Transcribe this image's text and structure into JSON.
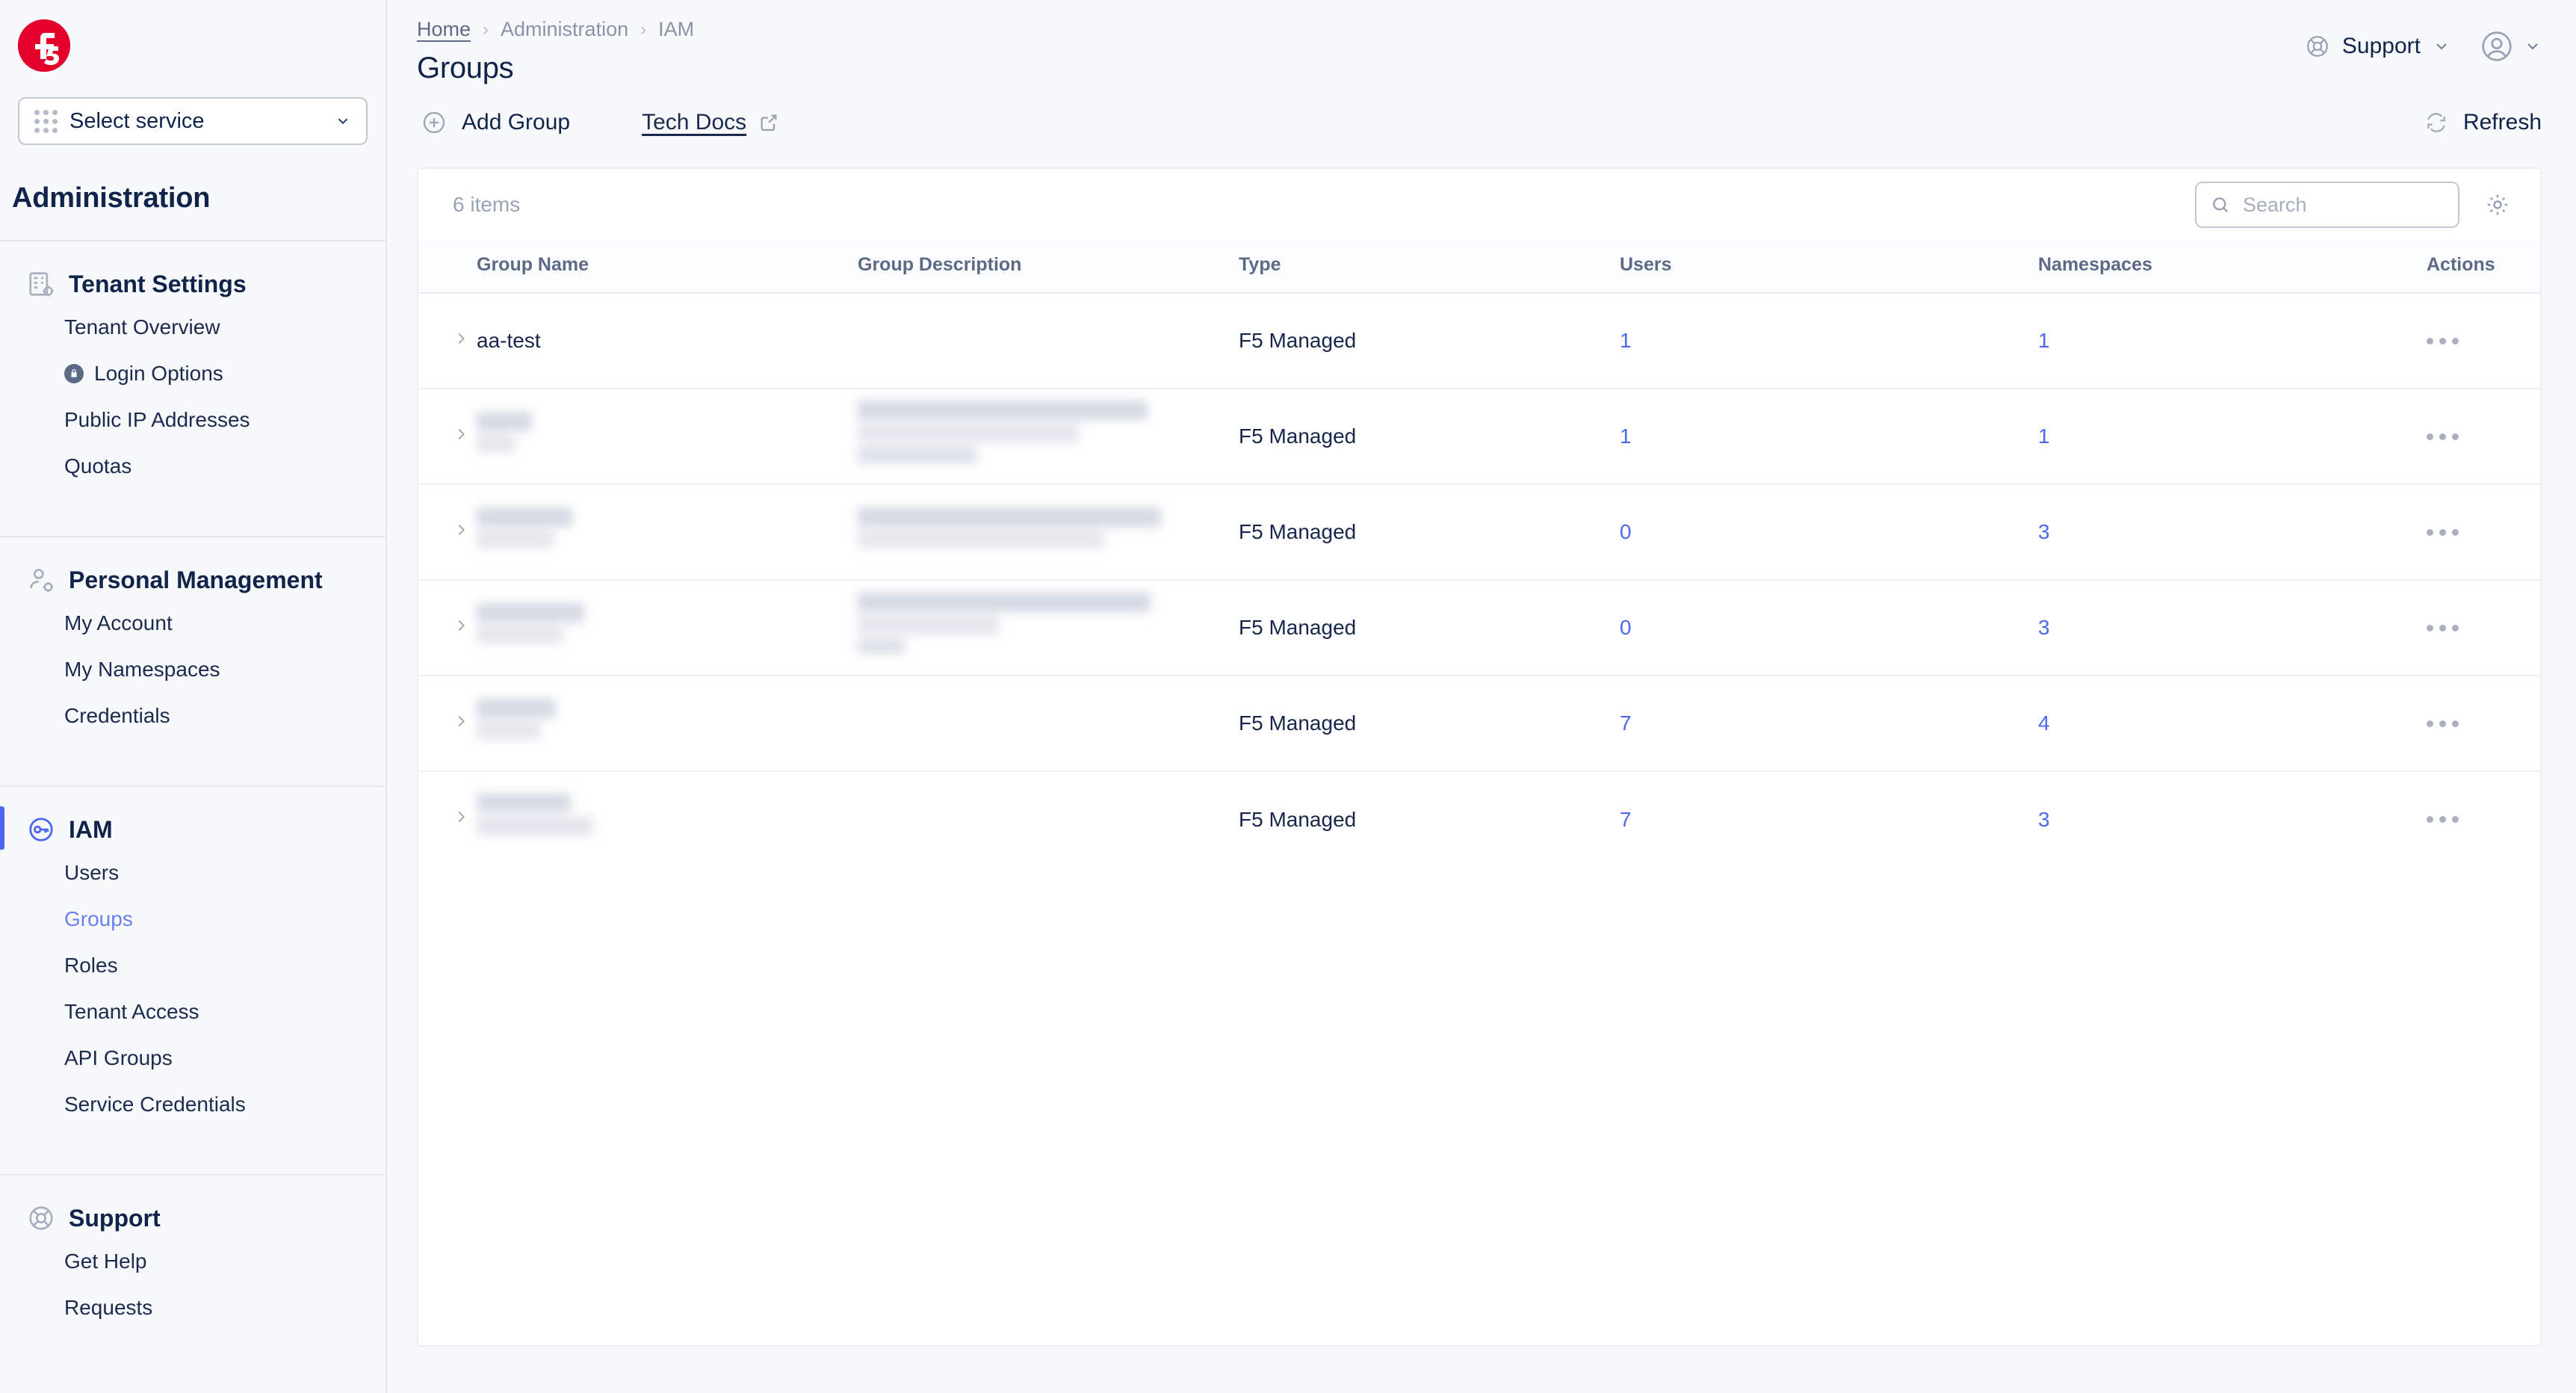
{
  "brand": {
    "logo_text": "f5",
    "logo_color": "#e4002b"
  },
  "sidebar": {
    "service_select": {
      "label": "Select service"
    },
    "title": "Administration",
    "sections": [
      {
        "label": "Tenant Settings",
        "icon": "building-gear-icon",
        "active": false,
        "items": [
          {
            "label": "Tenant Overview",
            "icon": null,
            "active": false
          },
          {
            "label": "Login Options",
            "icon": "lock-icon",
            "active": false
          },
          {
            "label": "Public IP Addresses",
            "icon": null,
            "active": false
          },
          {
            "label": "Quotas",
            "icon": null,
            "active": false
          }
        ]
      },
      {
        "label": "Personal Management",
        "icon": "user-gear-icon",
        "active": false,
        "items": [
          {
            "label": "My Account",
            "icon": null,
            "active": false
          },
          {
            "label": "My Namespaces",
            "icon": null,
            "active": false
          },
          {
            "label": "Credentials",
            "icon": null,
            "active": false
          }
        ]
      },
      {
        "label": "IAM",
        "icon": "key-circle-icon",
        "active": true,
        "items": [
          {
            "label": "Users",
            "icon": null,
            "active": false
          },
          {
            "label": "Groups",
            "icon": null,
            "active": true
          },
          {
            "label": "Roles",
            "icon": null,
            "active": false
          },
          {
            "label": "Tenant Access",
            "icon": null,
            "active": false
          },
          {
            "label": "API Groups",
            "icon": null,
            "active": false
          },
          {
            "label": "Service Credentials",
            "icon": null,
            "active": false
          }
        ]
      },
      {
        "label": "Support",
        "icon": "lifebuoy-icon",
        "active": false,
        "items": [
          {
            "label": "Get Help",
            "icon": null,
            "active": false
          },
          {
            "label": "Requests",
            "icon": null,
            "active": false
          }
        ]
      }
    ]
  },
  "header": {
    "breadcrumb": [
      {
        "label": "Home",
        "link": true
      },
      {
        "label": "Administration",
        "link": false
      },
      {
        "label": "IAM",
        "link": false
      }
    ],
    "separator": "›",
    "page_title": "Groups",
    "support_label": "Support",
    "support_icon": "lifebuoy-icon",
    "avatar_icon": "user-circle-icon"
  },
  "toolbar": {
    "add_group_label": "Add Group",
    "add_group_icon": "plus-circle-icon",
    "tech_docs_label": "Tech Docs",
    "tech_docs_icon": "external-link-icon",
    "refresh_label": "Refresh",
    "refresh_icon": "refresh-icon"
  },
  "table_card": {
    "items_count": "6 items",
    "search": {
      "placeholder": "Search",
      "value": "",
      "icon": "search-icon"
    },
    "settings_icon": "gear-icon",
    "columns": [
      "Group Name",
      "Group Description",
      "Type",
      "Users",
      "Namespaces",
      "Actions"
    ],
    "rows": [
      {
        "name": "aa-test",
        "name_redacted": false,
        "description": "",
        "desc_redacted": false,
        "type": "F5 Managed",
        "users": "1",
        "namespaces": "1"
      },
      {
        "name": "",
        "name_redacted": true,
        "description": "",
        "desc_redacted": true,
        "type": "F5 Managed",
        "users": "1",
        "namespaces": "1"
      },
      {
        "name": "",
        "name_redacted": true,
        "description": "",
        "desc_redacted": true,
        "type": "F5 Managed",
        "users": "0",
        "namespaces": "3"
      },
      {
        "name": "",
        "name_redacted": true,
        "description": "",
        "desc_redacted": true,
        "type": "F5 Managed",
        "users": "0",
        "namespaces": "3"
      },
      {
        "name": "",
        "name_redacted": true,
        "description": "",
        "desc_redacted": false,
        "type": "F5 Managed",
        "users": "7",
        "namespaces": "4"
      },
      {
        "name": "",
        "name_redacted": true,
        "description": "",
        "desc_redacted": false,
        "type": "F5 Managed",
        "users": "7",
        "namespaces": "3"
      }
    ]
  },
  "colors": {
    "accent": "#4d68f0",
    "brand_red": "#e4002b",
    "text_dark": "#10234a",
    "muted": "#9aa3b5"
  }
}
